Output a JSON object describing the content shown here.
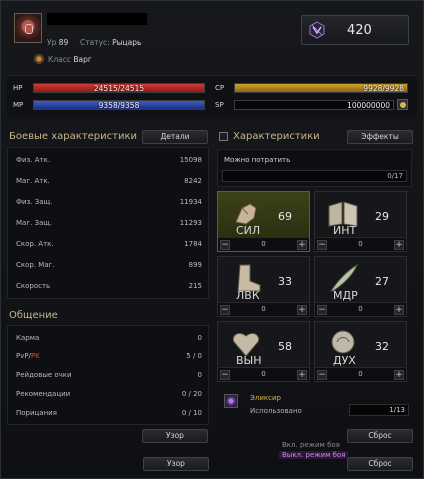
{
  "header": {
    "level_label": "Ур",
    "level": "89",
    "status_label": "Статус",
    "status": "Рыцарь",
    "class_label": "Класс",
    "class": "Варг",
    "score": "420"
  },
  "bars": {
    "hp": {
      "label": "HP",
      "text": "24515/24515",
      "current": 24515,
      "max": 24515
    },
    "mp": {
      "label": "MP",
      "text": "9358/9358",
      "current": 9358,
      "max": 9358
    },
    "cp": {
      "label": "CP",
      "text": "9928/9928",
      "current": 9928,
      "max": 9928
    },
    "sp": {
      "label": "SP",
      "text": "100000000"
    }
  },
  "combat": {
    "title": "Боевые характеристики",
    "details_button": "Детали",
    "rows": [
      {
        "k": "Физ. Атк.",
        "v": "15098"
      },
      {
        "k": "Маг. Атк.",
        "v": "8242"
      },
      {
        "k": "Физ. Защ.",
        "v": "11934"
      },
      {
        "k": "Маг. Защ.",
        "v": "11293"
      },
      {
        "k": "Скор. Атк.",
        "v": "1784"
      },
      {
        "k": "Скор. Маг.",
        "v": "899"
      },
      {
        "k": "Скорость",
        "v": "215"
      }
    ]
  },
  "social": {
    "title": "Общение",
    "karma_label": "Карма",
    "karma": "0",
    "pvp_label": "PvP/",
    "pk_label": "PK",
    "pvp_pk": "5 / 0",
    "raid_label": "Рейдовые очки",
    "raid": "0",
    "rec_label": "Рекомендации",
    "rec": "0 / 20",
    "censure_label": "Порицания",
    "censure": "0 / 10",
    "pattern_button": "Узор",
    "pattern_button_2": "Узор"
  },
  "attributes": {
    "title": "Характеристики",
    "effects_button": "Эффекты",
    "spend_label": "Можно потратить",
    "spend_value": "0/17",
    "items": [
      {
        "name": "СИЛ",
        "value": "69",
        "added": "0",
        "icon": "fist-icon"
      },
      {
        "name": "ИНТ",
        "value": "29",
        "added": "0",
        "icon": "book-icon"
      },
      {
        "name": "ЛВК",
        "value": "33",
        "added": "0",
        "icon": "boot-icon"
      },
      {
        "name": "МДР",
        "value": "27",
        "added": "0",
        "icon": "quill-icon"
      },
      {
        "name": "ВЫН",
        "value": "58",
        "added": "0",
        "icon": "heart-icon"
      },
      {
        "name": "ДУХ",
        "value": "32",
        "added": "0",
        "icon": "spirit-icon"
      }
    ],
    "elixir_title": "Эликсир",
    "elixir_used_label": "Использовано",
    "elixir_used": "1/13",
    "reset_button": "Сброс",
    "reset_button_2": "Сброс"
  },
  "tooltip": {
    "line1": "Вкл. режим боя",
    "line2": "Выкл. режим боя"
  },
  "colors": {
    "hp": "#c0302a",
    "mp": "#3550b0",
    "cp": "#c09020",
    "accent": "#c8b68c"
  }
}
